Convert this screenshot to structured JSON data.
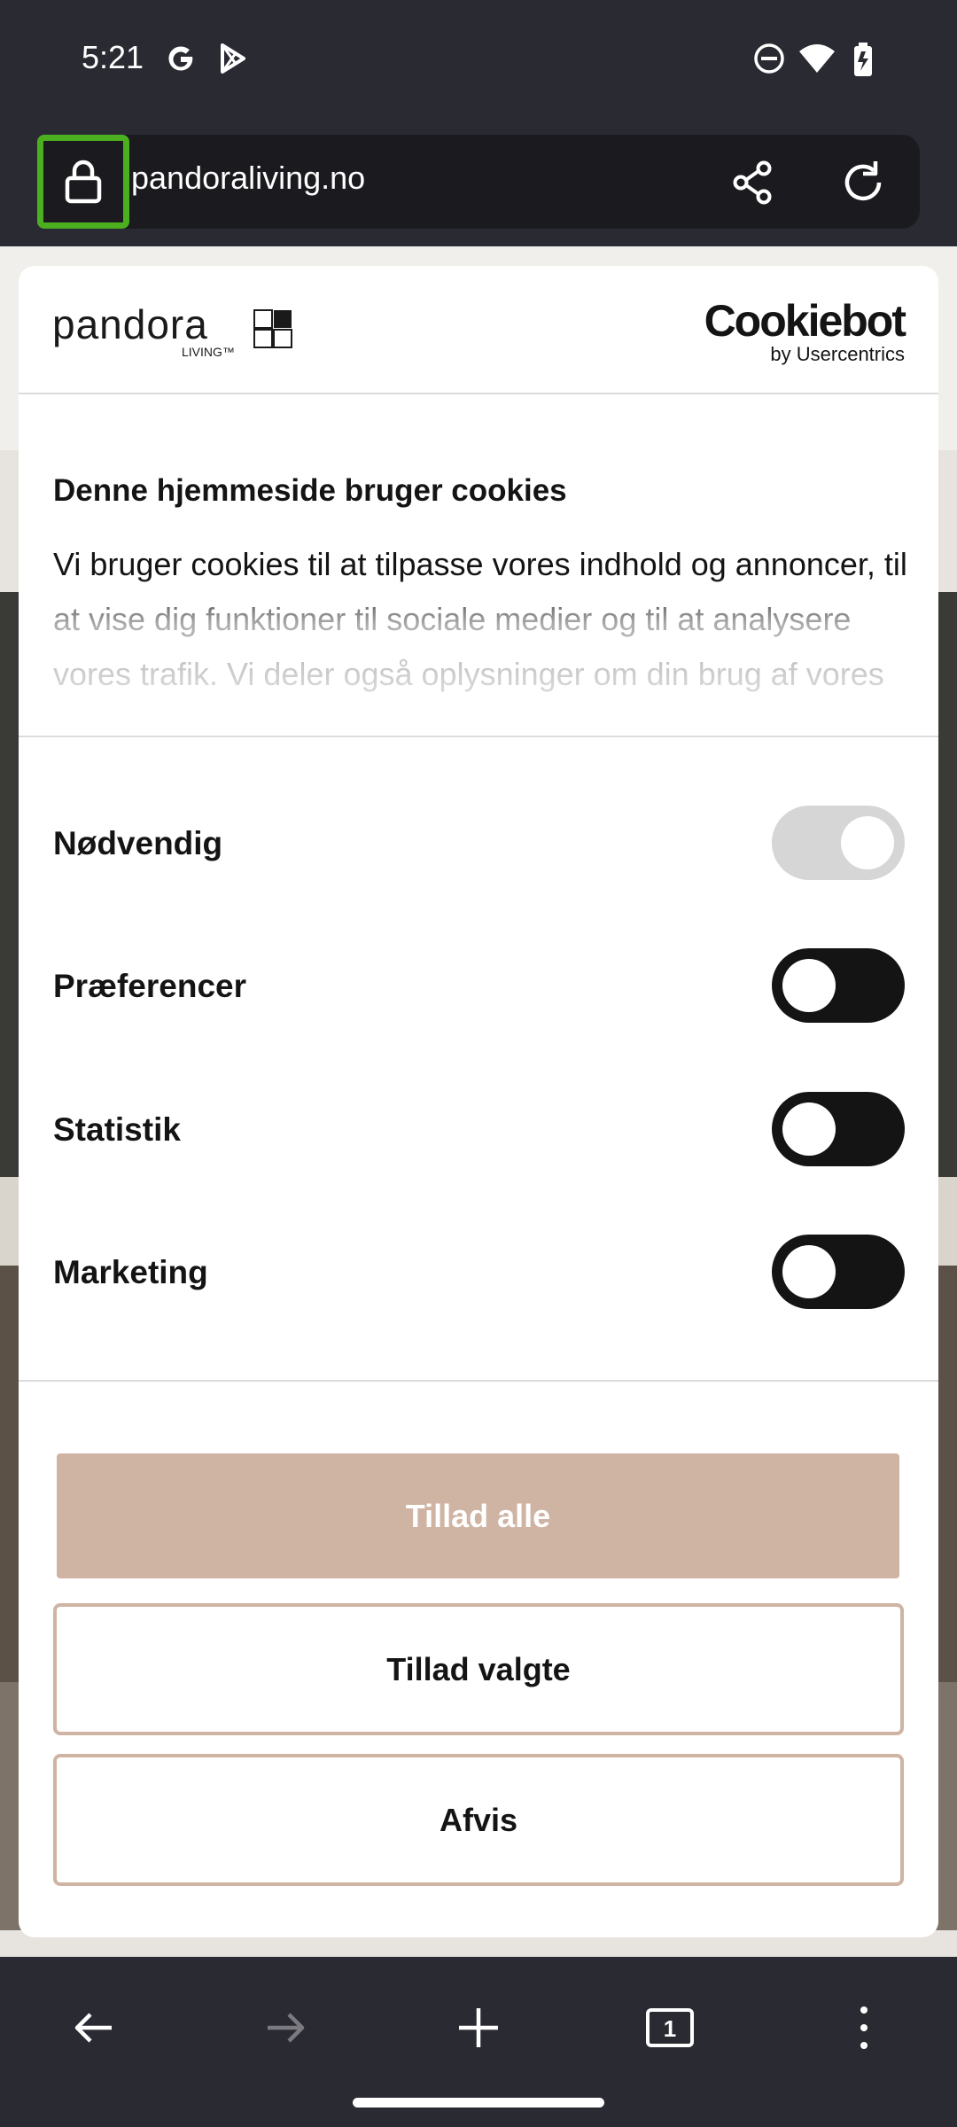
{
  "status_bar": {
    "time": "5:21",
    "left_icons": [
      "google-icon",
      "play-store-icon"
    ],
    "right_icons": [
      "do-not-disturb-icon",
      "wifi-icon",
      "battery-icon"
    ]
  },
  "browser": {
    "url": "pandoraliving.no",
    "actions": [
      "share-icon",
      "reload-icon"
    ]
  },
  "dialog": {
    "brand_logo": "pandora",
    "brand_logo_sub": "LIVING™",
    "cmp_logo_main": "Cookiebot",
    "cmp_logo_sub": "by Usercentrics",
    "title": "Denne hjemmeside bruger cookies",
    "description": "Vi bruger cookies til at tilpasse vores indhold og annoncer, til at vise dig funktioner til sociale medier og til at analysere vores trafik. Vi deler også oplysninger om din brug af vores hjemmeside med vores partnere inden for sociale medier, annonceringspartnere og analysepartnere.",
    "toggles": [
      {
        "label": "Nødvendig",
        "state": "on",
        "disabled": true
      },
      {
        "label": "Præferencer",
        "state": "off",
        "disabled": false
      },
      {
        "label": "Statistik",
        "state": "off",
        "disabled": false
      },
      {
        "label": "Marketing",
        "state": "off",
        "disabled": false
      }
    ],
    "buttons": {
      "allow_all": "Tillad alle",
      "allow_selected": "Tillad valgte",
      "decline": "Afvis"
    },
    "accent_color": "#cfb3a3"
  },
  "bottom_nav": {
    "tab_count": "1",
    "items": [
      "back-icon",
      "forward-icon",
      "new-tab-icon",
      "tab-switcher-icon",
      "more-options-icon"
    ]
  }
}
